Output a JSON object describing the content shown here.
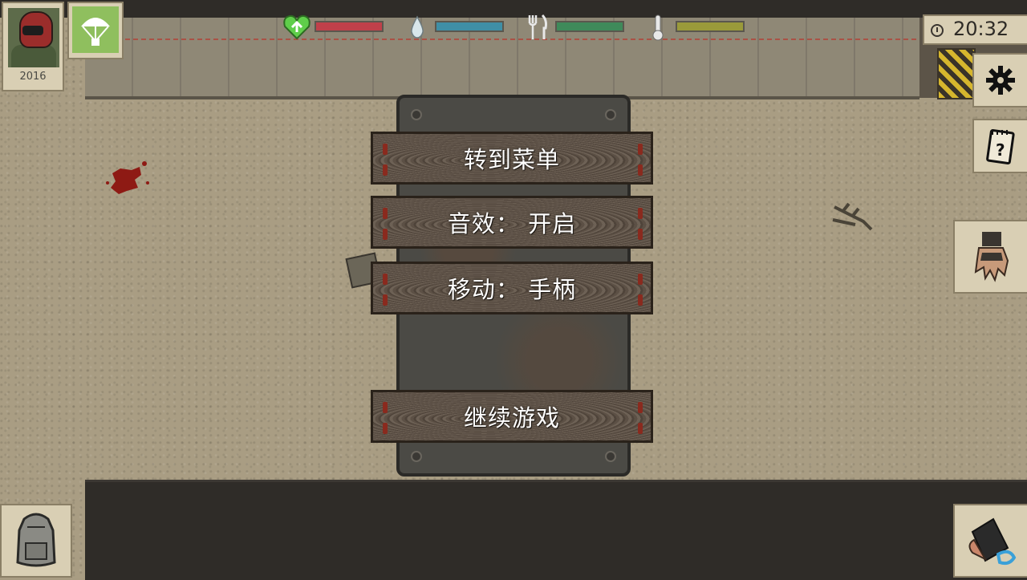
{
  "player": {
    "year": "2016"
  },
  "status": {
    "health": {
      "icon": "heart-icon",
      "color": "#c0404a",
      "level": 1.0
    },
    "thirst": {
      "icon": "water-drop-icon",
      "color": "#3f8fa6",
      "level": 1.0
    },
    "hunger": {
      "icon": "fork-knife-icon",
      "color": "#3f8a5a",
      "level": 1.0
    },
    "temperature": {
      "icon": "thermometer-icon",
      "color": "#9a9a3a",
      "level": 1.0
    }
  },
  "clock": {
    "time": "20:32"
  },
  "menu": {
    "go_to_menu": "转到菜单",
    "sound": "音效： 开启",
    "movement": "移动： 手柄",
    "continue": "继续游戏"
  },
  "icons": {
    "settings": "gear-icon",
    "journal": "notebook-icon",
    "hand": "hand-icon",
    "backpack": "backpack-icon",
    "weapon": "weapon-icon",
    "airdrop": "parachute-icon"
  }
}
